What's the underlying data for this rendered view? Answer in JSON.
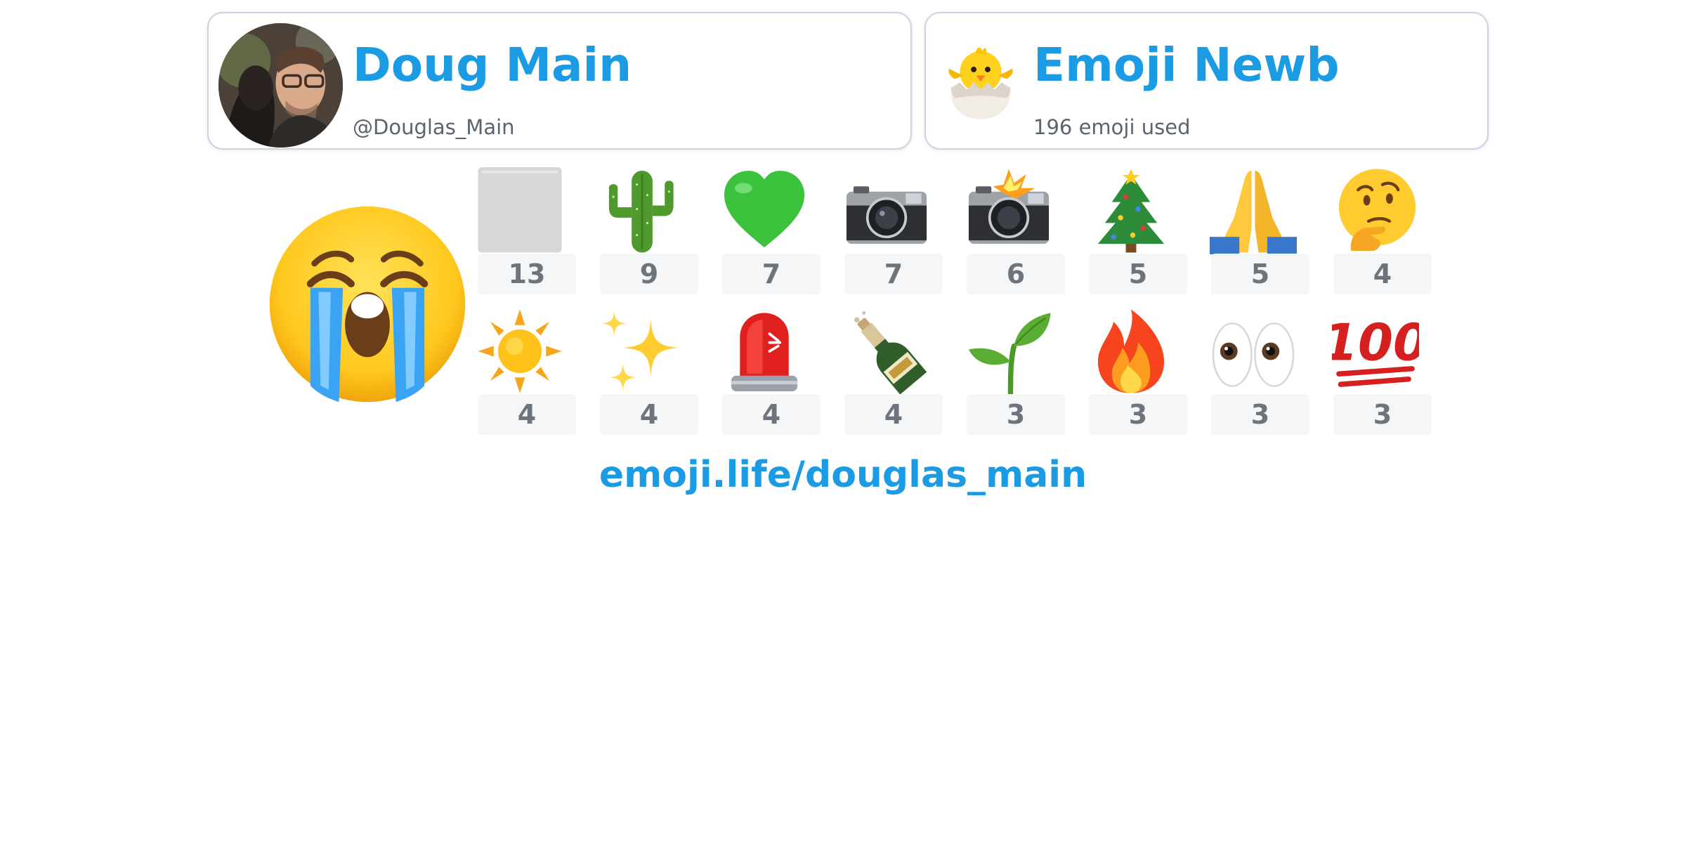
{
  "user": {
    "name": "Doug Main",
    "handle": "@Douglas_Main",
    "avatar": "user-photo"
  },
  "rank": {
    "title": "Emoji Newb",
    "subtitle": "196 emoji used",
    "badge_icon": "hatching-chick-icon"
  },
  "top_emoji": {
    "icon": "loudly-crying-face-icon"
  },
  "emoji_counts": [
    {
      "icon": "blank-tile-icon",
      "count": "13"
    },
    {
      "icon": "cactus-icon",
      "count": "9"
    },
    {
      "icon": "green-heart-icon",
      "count": "7"
    },
    {
      "icon": "camera-icon",
      "count": "7"
    },
    {
      "icon": "camera-with-flash-icon",
      "count": "6"
    },
    {
      "icon": "christmas-tree-icon",
      "count": "5"
    },
    {
      "icon": "folded-hands-icon",
      "count": "5"
    },
    {
      "icon": "thinking-face-icon",
      "count": "4"
    },
    {
      "icon": "sun-icon",
      "count": "4"
    },
    {
      "icon": "sparkles-icon",
      "count": "4"
    },
    {
      "icon": "police-light-icon",
      "count": "4"
    },
    {
      "icon": "champagne-bottle-icon",
      "count": "4"
    },
    {
      "icon": "seedling-icon",
      "count": "3"
    },
    {
      "icon": "fire-icon",
      "count": "3"
    },
    {
      "icon": "eyes-icon",
      "count": "3"
    },
    {
      "icon": "hundred-points-icon",
      "count": "3"
    }
  ],
  "footer": {
    "link_text": "emoji.life/douglas_main"
  },
  "colors": {
    "accent": "#1b9be4",
    "card_border": "#ccd3e0",
    "count_bg": "#f4f6f8",
    "count_text": "#6d747c"
  }
}
